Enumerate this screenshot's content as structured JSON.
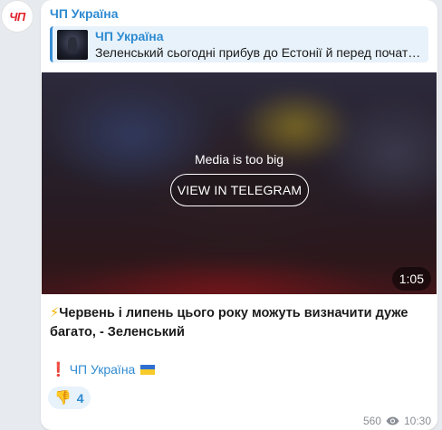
{
  "channel": {
    "avatar_text": "ЧП",
    "name": "ЧП Україна"
  },
  "reply": {
    "name": "ЧП Україна",
    "text": "Зеленський сьогодні прибув до Естонії й перед початком..."
  },
  "media": {
    "notice": "Media is too big",
    "button_label": "VIEW IN TELEGRAM",
    "duration": "1:05"
  },
  "message": {
    "text": "Червень і липень цього року можуть визначити дуже багато, - Зеленський",
    "bolt": "⚡",
    "signature_mark": "❗",
    "signature_channel": "ЧП Україна"
  },
  "reaction": {
    "icon": "thumbs-down-icon",
    "emoji": "👎",
    "count": "4"
  },
  "meta": {
    "views": "560",
    "time": "10:30"
  },
  "colors": {
    "accent": "#2e8bd1",
    "reply_bg": "#e8f2fb",
    "alert": "#e0242b"
  }
}
